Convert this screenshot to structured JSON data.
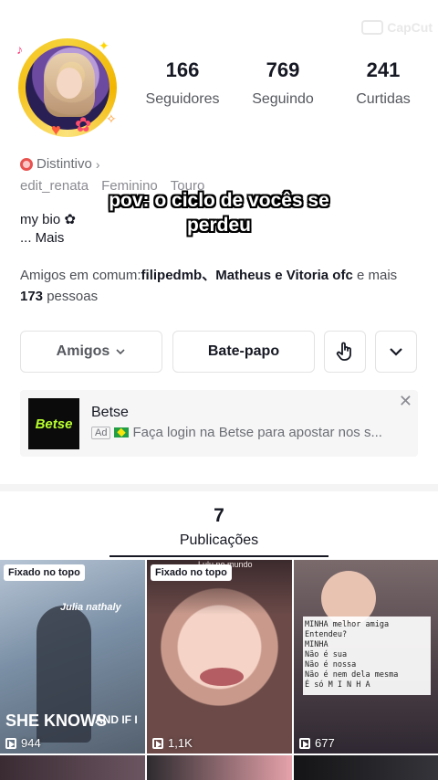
{
  "watermark": {
    "text": "CapCut"
  },
  "profile": {
    "stats": [
      {
        "value": "166",
        "label": "Seguidores"
      },
      {
        "value": "769",
        "label": "Seguindo"
      },
      {
        "value": "241",
        "label": "Curtidas"
      }
    ],
    "badge": "Distintivo",
    "username": "edit_renata",
    "gender": "Feminino",
    "sign": "Touro",
    "overlay_text": "pov: o ciclo de vocês se perdeu",
    "bio": "my bio ✿",
    "bio_more": "...  Mais",
    "mutual_prefix": "Amigos em comum:",
    "mutual_names": "filipedmb、Matheus e Vitoria ofc",
    "mutual_suffix_1": " e mais ",
    "mutual_count": "173",
    "mutual_suffix_2": " pessoas"
  },
  "actions": {
    "friends_label": "Amigos",
    "chat_label": "Bate-papo"
  },
  "ad": {
    "logo_text": "Betse",
    "title": "Betse",
    "tag": "Ad",
    "text": "Faça login na Betse para apostar nos s..."
  },
  "publications": {
    "count": "7",
    "label": "Publicações"
  },
  "videos": [
    {
      "pinned": "Fixado no topo",
      "views": "944",
      "text_a": "Julia nathaly",
      "text_b": "SHE KNOWS",
      "text_c": "AND IF I"
    },
    {
      "pinned": "Fixado no topo",
      "views": "1,1K",
      "text_top": "Lulu no mundo"
    },
    {
      "views": "677",
      "note": "MINHA melhor amiga\nEntendeu?\nMINHA\nNão é sua\nNão é nossa\nNão é nem dela mesma\nÉ só M I N H A"
    }
  ]
}
